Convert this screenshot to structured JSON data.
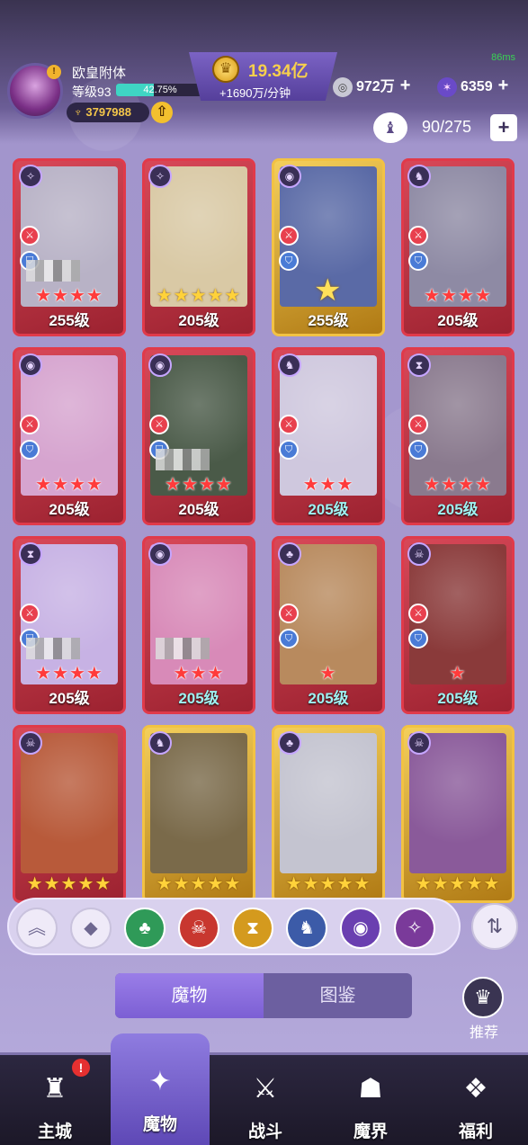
{
  "status": {
    "fps": "86ms"
  },
  "player": {
    "name": "欧皇附体",
    "level_label": "等级93",
    "xp_percent_text": "42.75%",
    "xp_fraction": 0.4275,
    "power": "3797988",
    "avatar_badge": "!"
  },
  "currency": {
    "gold": "19.34亿",
    "gold_rate": "+1690万/分钟",
    "resource1": "972万",
    "resource2": "6359"
  },
  "collection": {
    "count": "90/275"
  },
  "cards": [
    {
      "level": "255级",
      "stars": "★★★★",
      "frame": "red",
      "pixelated": true,
      "art": "#b8b2c6"
    },
    {
      "level": "205级",
      "stars": "★★★★★",
      "frame": "red",
      "star_color": "yellow",
      "art": "#d9c9a5"
    },
    {
      "level": "255级",
      "stars": "★",
      "frame": "gold",
      "big_star": true,
      "art": "#5a6aa6"
    },
    {
      "level": "205级",
      "stars": "★★★★",
      "frame": "red",
      "art": "#8e8aa4"
    },
    {
      "level": "205级",
      "stars": "★★★★",
      "frame": "red",
      "art": "#d6a4cf"
    },
    {
      "level": "205级",
      "stars": "★★★★",
      "frame": "red",
      "pixelated": true,
      "art": "#4a5a48"
    },
    {
      "level": "205级",
      "stars": "★★★",
      "frame": "red",
      "level_color": "cyan",
      "art": "#cfc8de"
    },
    {
      "level": "205级",
      "stars": "★★★★",
      "frame": "red",
      "level_color": "cyan",
      "art": "#8a7a8e"
    },
    {
      "level": "205级",
      "stars": "★★★★",
      "frame": "red",
      "pixelated": true,
      "art": "#c7b2e4"
    },
    {
      "level": "205级",
      "stars": "★★★",
      "frame": "red",
      "level_color": "cyan",
      "pixelated": true,
      "art": "#d88ab8"
    },
    {
      "level": "205级",
      "stars": "★",
      "frame": "red",
      "level_color": "cyan",
      "art": "#b88a5e"
    },
    {
      "level": "205级",
      "stars": "★",
      "frame": "red",
      "level_color": "cyan",
      "art": "#8a3a3a"
    },
    {
      "level": "",
      "stars": "★★★★★",
      "frame": "red",
      "star_color": "yellow",
      "art": "#b85a3a"
    },
    {
      "level": "",
      "stars": "★★★★★",
      "frame": "gold",
      "star_color": "yellow",
      "art": "#7a6a4a"
    },
    {
      "level": "",
      "stars": "★★★★★",
      "frame": "gold",
      "star_color": "yellow",
      "art": "#c4c4d0"
    },
    {
      "level": "",
      "stars": "★★★★★",
      "frame": "gold",
      "star_color": "yellow",
      "art": "#8a5a9a"
    }
  ],
  "filters": [
    {
      "name": "collapse-filter-icon",
      "glyph": "︽",
      "color": "#efeaf8"
    },
    {
      "name": "all-factions-icon",
      "glyph": "◆",
      "color": "#efeaf8"
    },
    {
      "name": "nature-faction-icon",
      "glyph": "♣",
      "color": "#2f9a58"
    },
    {
      "name": "beast-faction-icon",
      "glyph": "☠",
      "color": "#c8372f"
    },
    {
      "name": "time-faction-icon",
      "glyph": "⧗",
      "color": "#d49a1e"
    },
    {
      "name": "wolf-faction-icon",
      "glyph": "♞",
      "color": "#3c5ba8"
    },
    {
      "name": "eye-faction-icon",
      "glyph": "◉",
      "color": "#6a3fb0"
    },
    {
      "name": "chaos-faction-icon",
      "glyph": "✧",
      "color": "#7a3a9a"
    }
  ],
  "tabs": {
    "monsters": "魔物",
    "codex": "图鉴"
  },
  "recommend": {
    "label": "推荐"
  },
  "nav": [
    {
      "label": "主城",
      "icon": "castle-icon",
      "glyph": "♜",
      "badge": "!"
    },
    {
      "label": "魔物",
      "icon": "monster-flame-icon",
      "glyph": "✦",
      "active": true
    },
    {
      "label": "战斗",
      "icon": "battle-shield-icon",
      "glyph": "⚔"
    },
    {
      "label": "魔界",
      "icon": "demon-realm-icon",
      "glyph": "☗"
    },
    {
      "label": "福利",
      "icon": "treasure-chest-icon",
      "glyph": "❖"
    }
  ]
}
